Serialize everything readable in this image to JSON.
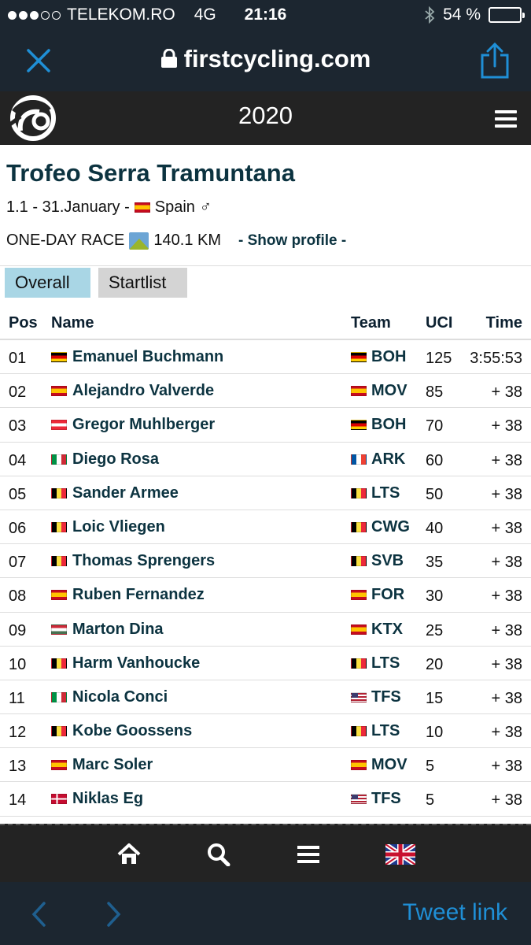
{
  "status_bar": {
    "carrier": "TELEKOM.RO",
    "network": "4G",
    "time": "21:16",
    "battery": "54 %",
    "battery_level": 0.54
  },
  "url_bar": {
    "domain": "firstcycling.com"
  },
  "site_header": {
    "year": "2020"
  },
  "race": {
    "title": "Trofeo Serra Tramuntana",
    "class_date": "1.1 - 31.January -",
    "country": "Spain",
    "gender_symbol": "♂",
    "type": "ONE-DAY RACE",
    "distance": "140.1 KM",
    "show_profile": "- Show profile -"
  },
  "tabs": {
    "overall": "Overall",
    "startlist": "Startlist"
  },
  "table": {
    "headers": {
      "pos": "Pos",
      "name": "Name",
      "team": "Team",
      "uci": "UCI",
      "time": "Time"
    },
    "rows": [
      {
        "pos": "01",
        "flag": "de",
        "name": "Emanuel Buchmann",
        "team_flag": "de",
        "team": "BOH",
        "uci": "125",
        "time": "3:55:53"
      },
      {
        "pos": "02",
        "flag": "es",
        "name": "Alejandro Valverde",
        "team_flag": "es",
        "team": "MOV",
        "uci": "85",
        "time": "+ 38"
      },
      {
        "pos": "03",
        "flag": "at",
        "name": "Gregor Muhlberger",
        "team_flag": "de",
        "team": "BOH",
        "uci": "70",
        "time": "+ 38"
      },
      {
        "pos": "04",
        "flag": "it",
        "name": "Diego Rosa",
        "team_flag": "fr",
        "team": "ARK",
        "uci": "60",
        "time": "+ 38"
      },
      {
        "pos": "05",
        "flag": "be",
        "name": "Sander Armee",
        "team_flag": "be",
        "team": "LTS",
        "uci": "50",
        "time": "+ 38"
      },
      {
        "pos": "06",
        "flag": "be",
        "name": "Loic Vliegen",
        "team_flag": "be",
        "team": "CWG",
        "uci": "40",
        "time": "+ 38"
      },
      {
        "pos": "07",
        "flag": "be",
        "name": "Thomas Sprengers",
        "team_flag": "be",
        "team": "SVB",
        "uci": "35",
        "time": "+ 38"
      },
      {
        "pos": "08",
        "flag": "es",
        "name": "Ruben Fernandez",
        "team_flag": "es",
        "team": "FOR",
        "uci": "30",
        "time": "+ 38"
      },
      {
        "pos": "09",
        "flag": "hu",
        "name": "Marton Dina",
        "team_flag": "es",
        "team": "KTX",
        "uci": "25",
        "time": "+ 38"
      },
      {
        "pos": "10",
        "flag": "be",
        "name": "Harm Vanhoucke",
        "team_flag": "be",
        "team": "LTS",
        "uci": "20",
        "time": "+ 38"
      },
      {
        "pos": "11",
        "flag": "it",
        "name": "Nicola Conci",
        "team_flag": "us",
        "team": "TFS",
        "uci": "15",
        "time": "+ 38"
      },
      {
        "pos": "12",
        "flag": "be",
        "name": "Kobe Goossens",
        "team_flag": "be",
        "team": "LTS",
        "uci": "10",
        "time": "+ 38"
      },
      {
        "pos": "13",
        "flag": "es",
        "name": "Marc Soler",
        "team_flag": "es",
        "team": "MOV",
        "uci": "5",
        "time": "+ 38"
      },
      {
        "pos": "14",
        "flag": "dk",
        "name": "Niklas Eg",
        "team_flag": "us",
        "team": "TFS",
        "uci": "5",
        "time": "+ 38"
      }
    ]
  },
  "bottom_nav": {
    "icons": [
      "home-icon",
      "search-icon",
      "menu-icon",
      "uk-flag-icon"
    ]
  },
  "toolbar": {
    "tweet_link": "Tweet link"
  },
  "colors": {
    "dark_bar": "#1c2630",
    "site_header": "#232323",
    "title": "#0c3340",
    "tab_active": "#a9d6e5",
    "tab_inactive": "#d4d4d4",
    "ios_blue": "#1f8fd6"
  }
}
